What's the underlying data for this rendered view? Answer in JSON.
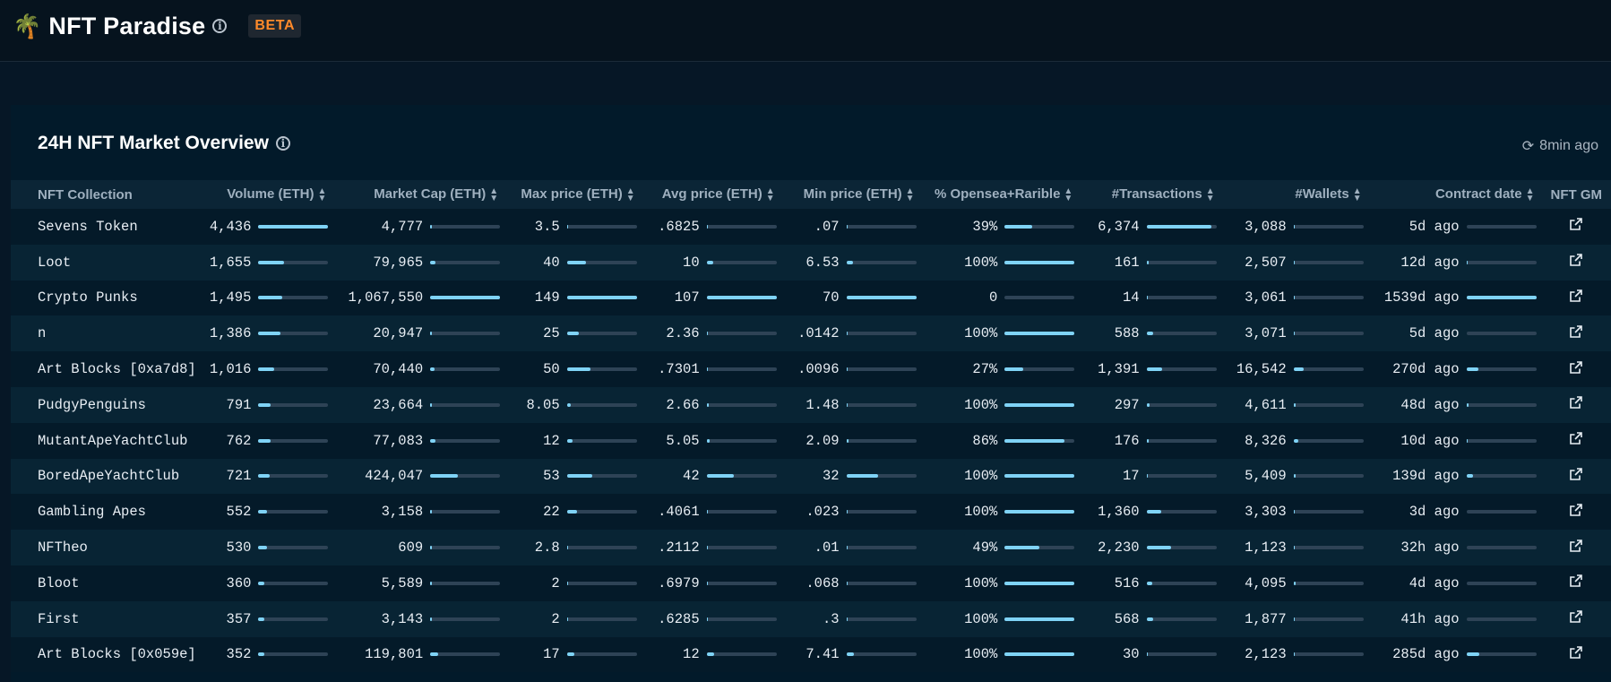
{
  "app": {
    "title": "NFT Paradise",
    "beta_label": "BETA",
    "info_icon": "info-icon",
    "logo_icon": "palm-tree-icon"
  },
  "panel": {
    "title": "24H NFT Market Overview",
    "updated": "8min ago",
    "refresh_icon": "refresh-icon"
  },
  "columns": [
    "NFT Collection",
    "Volume (ETH)",
    "Market Cap (ETH)",
    "Max price (ETH)",
    "Avg price (ETH)",
    "Min price (ETH)",
    "% Opensea+Rarible",
    "#Transactions",
    "#Wallets",
    "Contract date",
    "NFT GM"
  ],
  "colors": {
    "bar_fill": "#7fd3f6",
    "bar_track": "#2e4356",
    "beta": "#ff8a2a"
  },
  "rows": [
    {
      "name": "Sevens Token",
      "volume": "4,436",
      "volume_f": 1.0,
      "mcap": "4,777",
      "mcap_f": 0.01,
      "max": "3.5",
      "max_f": 0.02,
      "avg": ".6825",
      "avg_f": 0.01,
      "min": ".07",
      "min_f": 0.01,
      "pct": "39%",
      "pct_f": 0.39,
      "tx": "6,374",
      "tx_f": 0.93,
      "wallets": "3,088",
      "wallets_f": 0.02,
      "date": "5d ago",
      "date_f": 0.0
    },
    {
      "name": "Loot",
      "volume": "1,655",
      "volume_f": 0.37,
      "mcap": "79,965",
      "mcap_f": 0.075,
      "max": "40",
      "max_f": 0.27,
      "avg": "10",
      "avg_f": 0.093,
      "min": "6.53",
      "min_f": 0.093,
      "pct": "100%",
      "pct_f": 1.0,
      "tx": "161",
      "tx_f": 0.025,
      "wallets": "2,507",
      "wallets_f": 0.015,
      "date": "12d ago",
      "date_f": 0.01
    },
    {
      "name": "Crypto Punks",
      "volume": "1,495",
      "volume_f": 0.34,
      "mcap": "1,067,550",
      "mcap_f": 1.0,
      "max": "149",
      "max_f": 1.0,
      "avg": "107",
      "avg_f": 1.0,
      "min": "70",
      "min_f": 1.0,
      "pct": "0",
      "pct_f": 0.0,
      "tx": "14",
      "tx_f": 0.002,
      "wallets": "3,061",
      "wallets_f": 0.018,
      "date": "1539d ago",
      "date_f": 1.0
    },
    {
      "name": "n",
      "volume": "1,386",
      "volume_f": 0.31,
      "mcap": "20,947",
      "mcap_f": 0.02,
      "max": "25",
      "max_f": 0.17,
      "avg": "2.36",
      "avg_f": 0.022,
      "min": ".0142",
      "min_f": 0.01,
      "pct": "100%",
      "pct_f": 1.0,
      "tx": "588",
      "tx_f": 0.09,
      "wallets": "3,071",
      "wallets_f": 0.019,
      "date": "5d ago",
      "date_f": 0.0
    },
    {
      "name": "Art Blocks [0xa7d8]",
      "volume": "1,016",
      "volume_f": 0.23,
      "mcap": "70,440",
      "mcap_f": 0.066,
      "max": "50",
      "max_f": 0.34,
      "avg": ".7301",
      "avg_f": 0.01,
      "min": ".0096",
      "min_f": 0.01,
      "pct": "27%",
      "pct_f": 0.27,
      "tx": "1,391",
      "tx_f": 0.22,
      "wallets": "16,542",
      "wallets_f": 0.14,
      "date": "270d ago",
      "date_f": 0.175
    },
    {
      "name": "PudgyPenguins",
      "volume": "791",
      "volume_f": 0.18,
      "mcap": "23,664",
      "mcap_f": 0.022,
      "max": "8.05",
      "max_f": 0.054,
      "avg": "2.66",
      "avg_f": 0.025,
      "min": "1.48",
      "min_f": 0.021,
      "pct": "100%",
      "pct_f": 1.0,
      "tx": "297",
      "tx_f": 0.047,
      "wallets": "4,611",
      "wallets_f": 0.03,
      "date": "48d ago",
      "date_f": 0.031
    },
    {
      "name": "MutantApeYachtClub",
      "volume": "762",
      "volume_f": 0.17,
      "mcap": "77,083",
      "mcap_f": 0.072,
      "max": "12",
      "max_f": 0.08,
      "avg": "5.05",
      "avg_f": 0.047,
      "min": "2.09",
      "min_f": 0.03,
      "pct": "86%",
      "pct_f": 0.86,
      "tx": "176",
      "tx_f": 0.028,
      "wallets": "8,326",
      "wallets_f": 0.07,
      "date": "10d ago",
      "date_f": 0.007
    },
    {
      "name": "BoredApeYachtClub",
      "volume": "721",
      "volume_f": 0.16,
      "mcap": "424,047",
      "mcap_f": 0.4,
      "max": "53",
      "max_f": 0.36,
      "avg": "42",
      "avg_f": 0.39,
      "min": "32",
      "min_f": 0.46,
      "pct": "100%",
      "pct_f": 1.0,
      "tx": "17",
      "tx_f": 0.003,
      "wallets": "5,409",
      "wallets_f": 0.035,
      "date": "139d ago",
      "date_f": 0.09
    },
    {
      "name": "Gambling Apes",
      "volume": "552",
      "volume_f": 0.12,
      "mcap": "3,158",
      "mcap_f": 0.01,
      "max": "22",
      "max_f": 0.15,
      "avg": ".4061",
      "avg_f": 0.01,
      "min": ".023",
      "min_f": 0.01,
      "pct": "100%",
      "pct_f": 1.0,
      "tx": "1,360",
      "tx_f": 0.21,
      "wallets": "3,303",
      "wallets_f": 0.02,
      "date": "3d ago",
      "date_f": 0.0
    },
    {
      "name": "NFTheo",
      "volume": "530",
      "volume_f": 0.12,
      "mcap": "609",
      "mcap_f": 0.005,
      "max": "2.8",
      "max_f": 0.019,
      "avg": ".2112",
      "avg_f": 0.01,
      "min": ".01",
      "min_f": 0.01,
      "pct": "49%",
      "pct_f": 0.49,
      "tx": "2,230",
      "tx_f": 0.35,
      "wallets": "1,123",
      "wallets_f": 0.01,
      "date": "32h ago",
      "date_f": 0.0
    },
    {
      "name": "Bloot",
      "volume": "360",
      "volume_f": 0.08,
      "mcap": "5,589",
      "mcap_f": 0.01,
      "max": "2",
      "max_f": 0.013,
      "avg": ".6979",
      "avg_f": 0.01,
      "min": ".068",
      "min_f": 0.01,
      "pct": "100%",
      "pct_f": 1.0,
      "tx": "516",
      "tx_f": 0.08,
      "wallets": "4,095",
      "wallets_f": 0.025,
      "date": "4d ago",
      "date_f": 0.0
    },
    {
      "name": "First",
      "volume": "357",
      "volume_f": 0.08,
      "mcap": "3,143",
      "mcap_f": 0.01,
      "max": "2",
      "max_f": 0.013,
      "avg": ".6285",
      "avg_f": 0.01,
      "min": ".3",
      "min_f": 0.01,
      "pct": "100%",
      "pct_f": 1.0,
      "tx": "568",
      "tx_f": 0.09,
      "wallets": "1,877",
      "wallets_f": 0.012,
      "date": "41h ago",
      "date_f": 0.0
    },
    {
      "name": "Art Blocks [0x059e]",
      "volume": "352",
      "volume_f": 0.08,
      "mcap": "119,801",
      "mcap_f": 0.11,
      "max": "17",
      "max_f": 0.11,
      "avg": "12",
      "avg_f": 0.11,
      "min": "7.41",
      "min_f": 0.106,
      "pct": "100%",
      "pct_f": 1.0,
      "tx": "30",
      "tx_f": 0.005,
      "wallets": "2,123",
      "wallets_f": 0.013,
      "date": "285d ago",
      "date_f": 0.185
    }
  ]
}
